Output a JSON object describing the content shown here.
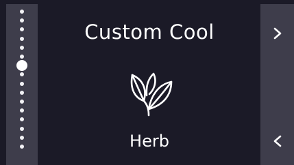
{
  "screen": {
    "title": "Custom Cool",
    "mode_label": "Herb",
    "mode_icon": "herb-leaf-icon"
  },
  "pager": {
    "total_pages": 16,
    "active_index": 6
  },
  "navigation": {
    "next_glyph": ">",
    "prev_glyph": "<"
  },
  "colors": {
    "background": "#1b1a27",
    "rail": "#3e3d4b",
    "foreground": "#ffffff"
  }
}
